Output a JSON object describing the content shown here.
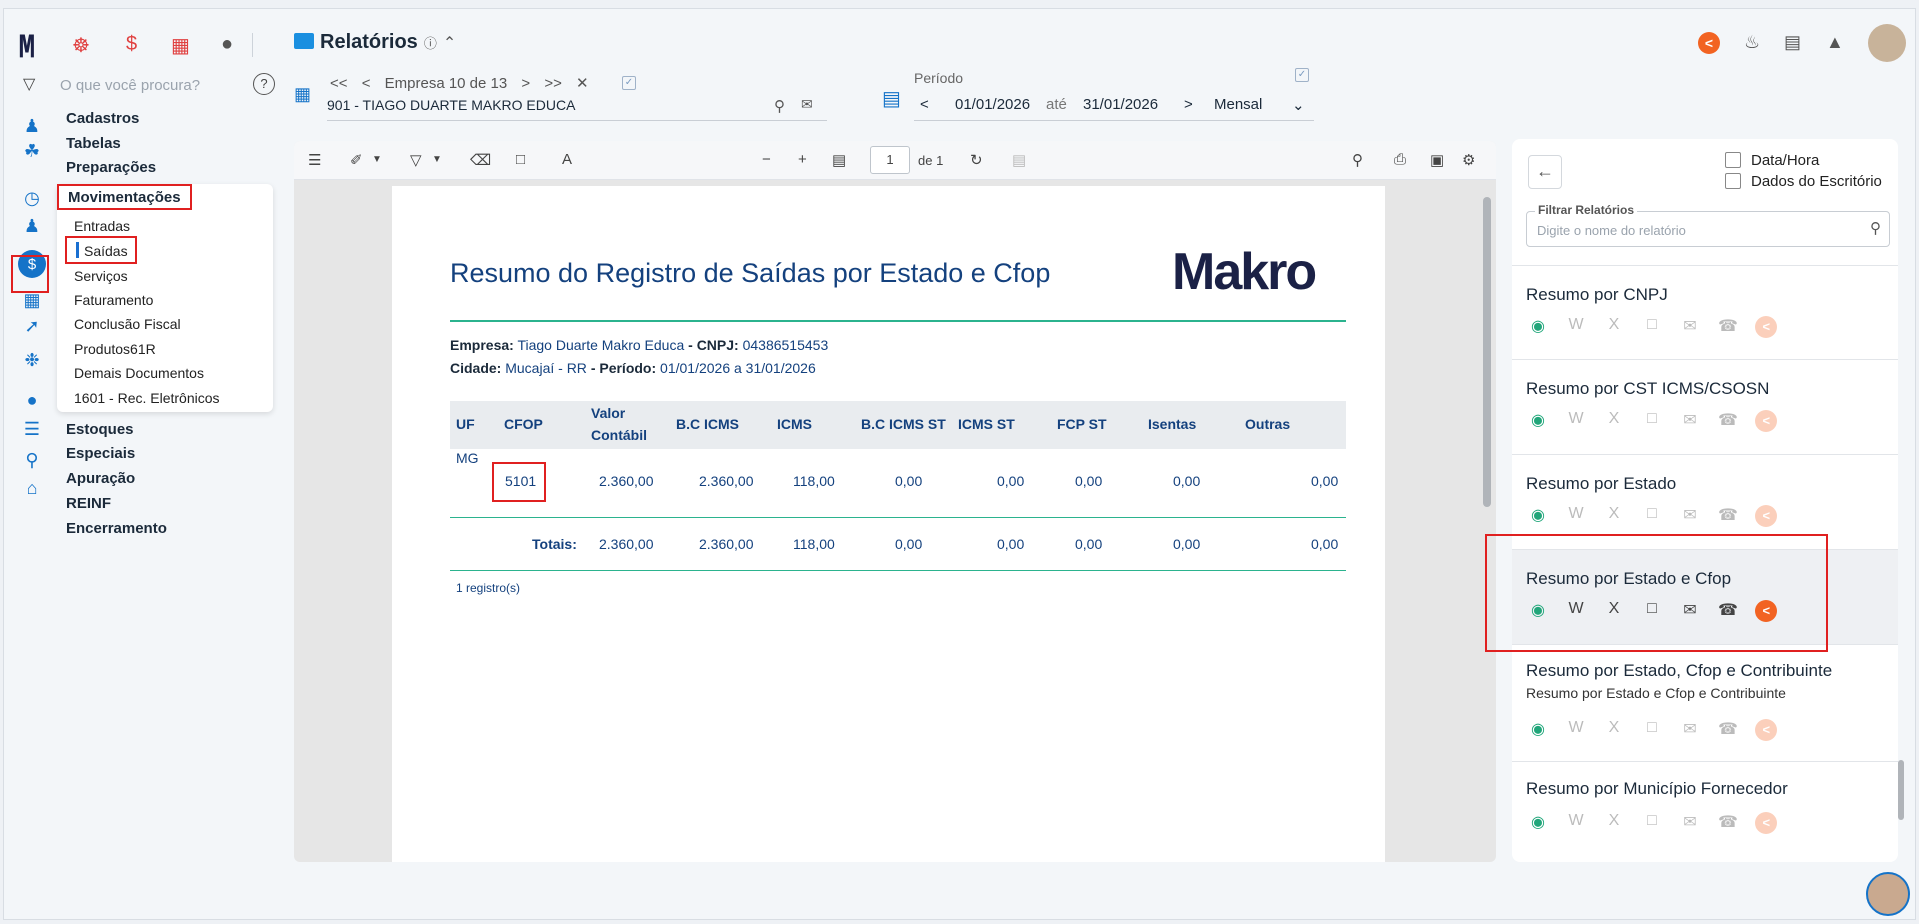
{
  "app": {
    "title": "Relatórios"
  },
  "sidebar": {
    "search_placeholder": "O que você procura?",
    "help": "?",
    "items_top": [
      "Cadastros",
      "Tabelas",
      "Preparações",
      "Movimentações"
    ],
    "submenu": [
      "Entradas",
      "Saídas",
      "Serviços",
      "Faturamento",
      "Conclusão Fiscal",
      "Produtos61R",
      "Demais Documentos",
      "1601 - Rec. Eletrônicos"
    ],
    "items_bottom": [
      "Estoques",
      "Especiais",
      "Apuração",
      "REINF",
      "Encerramento"
    ]
  },
  "header": {
    "empresa_first": "<<",
    "empresa_prev": "<",
    "empresa_counter": "Empresa 10 de 13",
    "empresa_next": ">",
    "empresa_last": ">>",
    "empresa_clear": "✕",
    "empresa_name": "901 - TIAGO DUARTE MAKRO EDUCA",
    "periodo_label": "Período",
    "date_from": "01/01/2026",
    "date_sep": "até",
    "date_to": "31/01/2026",
    "freq": "Mensal"
  },
  "viewer": {
    "page_value": "1",
    "page_total": "de 1"
  },
  "report": {
    "title": "Resumo do Registro de Saídas por Estado e Cfop",
    "logo": "Makro",
    "empresa_label": "Empresa:",
    "empresa_value": "Tiago Duarte Makro Educa",
    "cnpj_label": "- CNPJ:",
    "cnpj_value": "04386515453",
    "cidade_label": "Cidade:",
    "cidade_value": "Mucajaí - RR",
    "periodo_label": "- Período:",
    "periodo_value": "01/01/2026 a 31/01/2026",
    "columns": [
      "UF",
      "CFOP",
      "Valor",
      "Contábil",
      "B.C ICMS",
      "ICMS",
      "B.C ICMS ST",
      "ICMS ST",
      "FCP ST",
      "Isentas",
      "Outras"
    ],
    "row": {
      "uf": "MG",
      "cfop": "5101",
      "vals": [
        "2.360,00",
        "2.360,00",
        "118,00",
        "0,00",
        "0,00",
        "0,00",
        "0,00",
        "0,00"
      ]
    },
    "totais_label": "Totais:",
    "totais": [
      "2.360,00",
      "2.360,00",
      "118,00",
      "0,00",
      "0,00",
      "0,00",
      "0,00",
      "0,00"
    ],
    "registros": "1 registro(s)"
  },
  "panel": {
    "opt_datahora": "Data/Hora",
    "opt_escritorio": "Dados do Escritório",
    "filter_legend": "Filtrar Relatórios",
    "filter_placeholder": "Digite o nome do relatório",
    "cards": [
      {
        "title": "Resumo por CNPJ",
        "sub": ""
      },
      {
        "title": "Resumo por CST ICMS/CSOSN",
        "sub": ""
      },
      {
        "title": "Resumo por Estado",
        "sub": ""
      },
      {
        "title": "Resumo por Estado e Cfop",
        "sub": ""
      },
      {
        "title": "Resumo por Estado, Cfop e Contribuinte",
        "sub": "Resumo por Estado e Cfop e Contribuinte"
      },
      {
        "title": "Resumo por Município Fornecedor",
        "sub": ""
      }
    ]
  },
  "colors": {
    "accent": "#1573c8",
    "highlight": "#e02020",
    "orange": "#f26322",
    "green": "#2bb38e"
  }
}
